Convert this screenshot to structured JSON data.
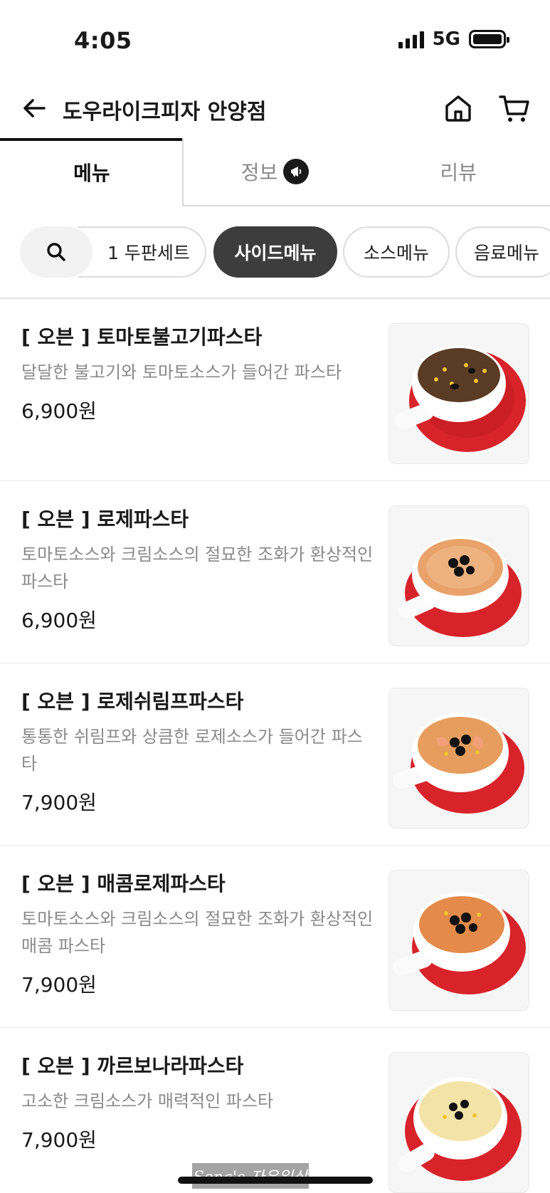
{
  "status_bar": {
    "time": "4:05",
    "network": "5G"
  },
  "header": {
    "title": "도우라이크피자 안양점"
  },
  "tabs": [
    {
      "label": "메뉴",
      "active": true
    },
    {
      "label": "정보",
      "active": false
    },
    {
      "label": "리뷰",
      "active": false
    }
  ],
  "categories": [
    {
      "label": "1 두판세트",
      "active": false
    },
    {
      "label": "사이드메뉴",
      "active": true
    },
    {
      "label": "소스메뉴",
      "active": false
    },
    {
      "label": "음료메뉴",
      "active": false
    }
  ],
  "menu_items": [
    {
      "name": "[ 오븐 ] 토마토불고기파스타",
      "description": "달달한 불고기와 토마토소스가 들어간 파스타",
      "price": "6,900원",
      "image_icon": "tomato-bulgogi-pasta-image"
    },
    {
      "name": "[ 오븐 ] 로제파스타",
      "description": "토마토소스와 크림소스의 절묘한 조화가 환상적인 파스타",
      "price": "6,900원",
      "image_icon": "rose-pasta-image"
    },
    {
      "name": "[ 오븐 ] 로제쉬림프파스타",
      "description": "통통한 쉬림프와 상큼한 로제소스가 들어간 파스타",
      "price": "7,900원",
      "image_icon": "rose-shrimp-pasta-image"
    },
    {
      "name": "[ 오븐 ] 매콤로제파스타",
      "description": "토마토소스와 크림소스의 절묘한 조화가 환상적인 매콤 파스타",
      "price": "7,900원",
      "image_icon": "spicy-rose-pasta-image"
    },
    {
      "name": "[ 오븐 ] 까르보나라파스타",
      "description": "고소한 크림소스가 매력적인 파스타",
      "price": "7,900원",
      "image_icon": "carbonara-pasta-image"
    }
  ],
  "watermark": "Sena's 자유일상",
  "colors": {
    "active_chip": "#3d3d3d",
    "plate_red": "#d8232a",
    "muted_text": "#8a8a8a"
  }
}
